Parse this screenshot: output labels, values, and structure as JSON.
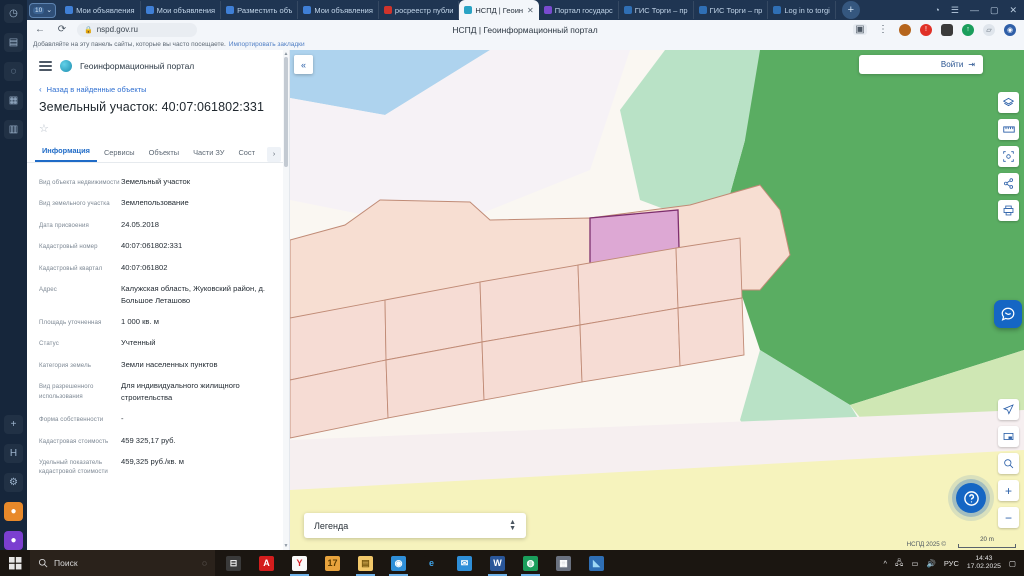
{
  "browser": {
    "tabgroup_badge": "10",
    "tabs": [
      {
        "label": "Мои объявления",
        "favicon": "avito-icon",
        "color": "#3f7fd6",
        "active": false
      },
      {
        "label": "Мои объявления",
        "favicon": "avito-icon",
        "color": "#3f7fd6",
        "active": false
      },
      {
        "label": "Разместить объ",
        "favicon": "avito-icon",
        "color": "#3f7fd6",
        "active": false
      },
      {
        "label": "Мои объявления",
        "favicon": "avito-icon",
        "color": "#3f7fd6",
        "active": false
      },
      {
        "label": "росреестр публи",
        "favicon": "rosreestr-icon",
        "color": "#d0342c",
        "active": false
      },
      {
        "label": "НСПД | Геоин",
        "favicon": "nspd-icon",
        "color": "#2aa3c4",
        "active": true
      },
      {
        "label": "Портал государс",
        "favicon": "gosuslugi-icon",
        "color": "#7a4bd0",
        "active": false
      },
      {
        "label": "ГИС Торги – пр",
        "favicon": "torgi-icon",
        "color": "#2f6fb5",
        "active": false
      },
      {
        "label": "ГИС Торги – пр",
        "favicon": "torgi-icon",
        "color": "#2f6fb5",
        "active": false
      },
      {
        "label": "Log in to torgi",
        "favicon": "torgi-icon",
        "color": "#2f6fb5",
        "active": false
      }
    ],
    "new_tab_label": "+",
    "window_controls": [
      "notifications-bell-icon",
      "menu-icon",
      "minimize-icon",
      "restore-icon",
      "close-icon"
    ],
    "nav": {
      "back_icon": "arrow-left-icon",
      "reload_icon": "reload-icon",
      "lock_icon": "lock-icon",
      "url": "nspd.gov.ru",
      "page_title": "НСПД | Геоинформационный портал",
      "bookmark_icon": "bookmark-icon",
      "more_icon": "kebab-menu-icon",
      "extensions": [
        {
          "name": "extension-icon-1",
          "color": "#b5651d",
          "glyph": ""
        },
        {
          "name": "extension-icon-2",
          "color": "#e03127",
          "glyph": "!"
        },
        {
          "name": "extension-icon-3",
          "color": "#3b3b3b",
          "glyph": ""
        },
        {
          "name": "extension-icon-4",
          "color": "#1a9e5c",
          "glyph": "↑"
        },
        {
          "name": "extension-icon-5",
          "color": "#f0f2f5",
          "glyph": ""
        },
        {
          "name": "profile-avatar-icon",
          "color": "#2f5fa8",
          "glyph": ""
        }
      ]
    },
    "bookmark_bar": {
      "text": "Добавляйте на эту панель сайты, которые вы часто посещаете.",
      "link": "Импортировать закладки"
    },
    "rail_icons": [
      "history-icon",
      "reader-icon",
      "downloads-icon",
      "sync-icon",
      "apps-icon",
      "collections-icon",
      "add-icon",
      "help-icon",
      "settings-icon",
      "profile-icon",
      "more-icon"
    ]
  },
  "panel": {
    "menu_icon": "hamburger-menu-icon",
    "logo_icon": "nspd-logo-icon",
    "title": "Геоинформационный портал",
    "back_link": "Назад в найденные объекты",
    "back_chevron_icon": "chevron-left-icon",
    "object_title": "Земельный участок: 40:07:061802:331",
    "favorite_icon": "star-outline-icon",
    "tabs": [
      {
        "label": "Информация",
        "selected": true
      },
      {
        "label": "Сервисы",
        "selected": false
      },
      {
        "label": "Объекты",
        "selected": false
      },
      {
        "label": "Части ЗУ",
        "selected": false
      },
      {
        "label": "Сост",
        "selected": false
      }
    ],
    "tabs_more_icon": "chevron-right-icon",
    "fields": [
      {
        "key": "Вид объекта недвижимости",
        "value": "Земельный участок"
      },
      {
        "key": "Вид земельного участка",
        "value": "Землепользование"
      },
      {
        "key": "Дата присвоения",
        "value": "24.05.2018"
      },
      {
        "key": "Кадастровый номер",
        "value": "40:07:061802:331"
      },
      {
        "key": "Кадастровый квартал",
        "value": "40:07:061802"
      },
      {
        "key": "Адрес",
        "value": "Калужская область, Жуковский район, д. Большое Леташово"
      },
      {
        "key": "Площадь уточненная",
        "value": "1 000 кв. м"
      },
      {
        "key": "Статус",
        "value": "Учтенный"
      },
      {
        "key": "Категория земель",
        "value": "Земли населенных пунктов"
      },
      {
        "key": "Вид разрешенного использования",
        "value": "Для индивидуального жилищного строительства"
      },
      {
        "key": "Форма собственности",
        "value": "-"
      },
      {
        "key": "Кадастровая стоимость",
        "value": "459 325,17 руб."
      },
      {
        "key": "Удельный показатель кадастровой стоимости",
        "value": "459,325 руб./кв. м"
      }
    ],
    "scroll_up_icon": "caret-up-icon",
    "scroll_down_icon": "caret-down-icon"
  },
  "map": {
    "collapse_panel_icon": "double-chevron-left-icon",
    "login_label": "Войти",
    "login_icon": "login-arrow-icon",
    "tools_top": [
      {
        "name": "layers-icon"
      },
      {
        "name": "ruler-icon"
      },
      {
        "name": "select-area-icon"
      },
      {
        "name": "share-icon"
      },
      {
        "name": "print-icon"
      }
    ],
    "tools_bottom": [
      {
        "name": "locate-me-icon"
      },
      {
        "name": "minimap-icon"
      },
      {
        "name": "search-map-icon"
      },
      {
        "name": "zoom-in-icon",
        "label": "+"
      },
      {
        "name": "zoom-out-icon",
        "label": "−"
      }
    ],
    "chat_icon": "chat-bubble-icon",
    "help_icon": "question-bubble-icon",
    "legend_label": "Легенда",
    "legend_spinner_icon": "up-down-caret-icon",
    "credit": "НСПД 2025 ©",
    "scale_label": "20 m",
    "colors": {
      "selected_parcel_fill": "#dda8d4",
      "selected_parcel_stroke": "#7d2f6e",
      "parcel_fill": "#f7ded2",
      "parcel_stroke": "#c08b76",
      "forest_fill": "#5aad62",
      "meadow_fill": "#f6f3bd",
      "water_fill": "#aed3ee",
      "green_zone_fill": "#b9e2c6",
      "background_fill": "#faf7f2"
    }
  },
  "taskbar": {
    "start_icon": "windows-start-icon",
    "search_icon": "search-icon",
    "search_placeholder": "Поиск",
    "cortana_icon": "cortana-icon",
    "items": [
      {
        "name": "task-view-icon",
        "glyph": "⊟",
        "bg": "#3a3a3a",
        "color": "#e8e8e8",
        "open": false
      },
      {
        "name": "acrobat-reader-icon",
        "glyph": "A",
        "bg": "#d41d1d",
        "color": "#ffffff",
        "open": false
      },
      {
        "name": "yandex-browser-icon",
        "glyph": "Y",
        "bg": "#fafafa",
        "color": "#d8232a",
        "open": true
      },
      {
        "name": "calendar-icon",
        "glyph": "17",
        "bg": "#e8a33d",
        "color": "#5a3b00",
        "open": false
      },
      {
        "name": "file-explorer-icon",
        "glyph": "▤",
        "bg": "#f2c86a",
        "color": "#7a5a10",
        "open": true
      },
      {
        "name": "chrome-browser-icon",
        "glyph": "◉",
        "bg": "#2f8fd8",
        "color": "#ffffff",
        "open": true
      },
      {
        "name": "edge-browser-icon",
        "glyph": "e",
        "bg": "#1b1611",
        "color": "#3fa3e8",
        "open": false
      },
      {
        "name": "mail-icon",
        "glyph": "✉",
        "bg": "#2f8fd8",
        "color": "#ffffff",
        "open": false
      },
      {
        "name": "word-icon",
        "glyph": "W",
        "bg": "#2a5699",
        "color": "#ffffff",
        "open": true
      },
      {
        "name": "gis-app-icon",
        "glyph": "◍",
        "bg": "#1a9e5c",
        "color": "#ffffff",
        "open": true
      },
      {
        "name": "calculator-icon",
        "glyph": "▦",
        "bg": "#6b7280",
        "color": "#ffffff",
        "open": false
      },
      {
        "name": "photos-icon",
        "glyph": "◣",
        "bg": "#2f6fb5",
        "color": "#9fd8f5",
        "open": false
      }
    ],
    "tray": {
      "expand_icon": "chevron-up-icon",
      "net_icon": "network-icon",
      "monitor_icon": "display-icon",
      "volume_icon": "volume-icon",
      "language": "РУС",
      "time": "14:43",
      "date": "17.02.2025",
      "notifications_icon": "action-center-icon"
    }
  }
}
